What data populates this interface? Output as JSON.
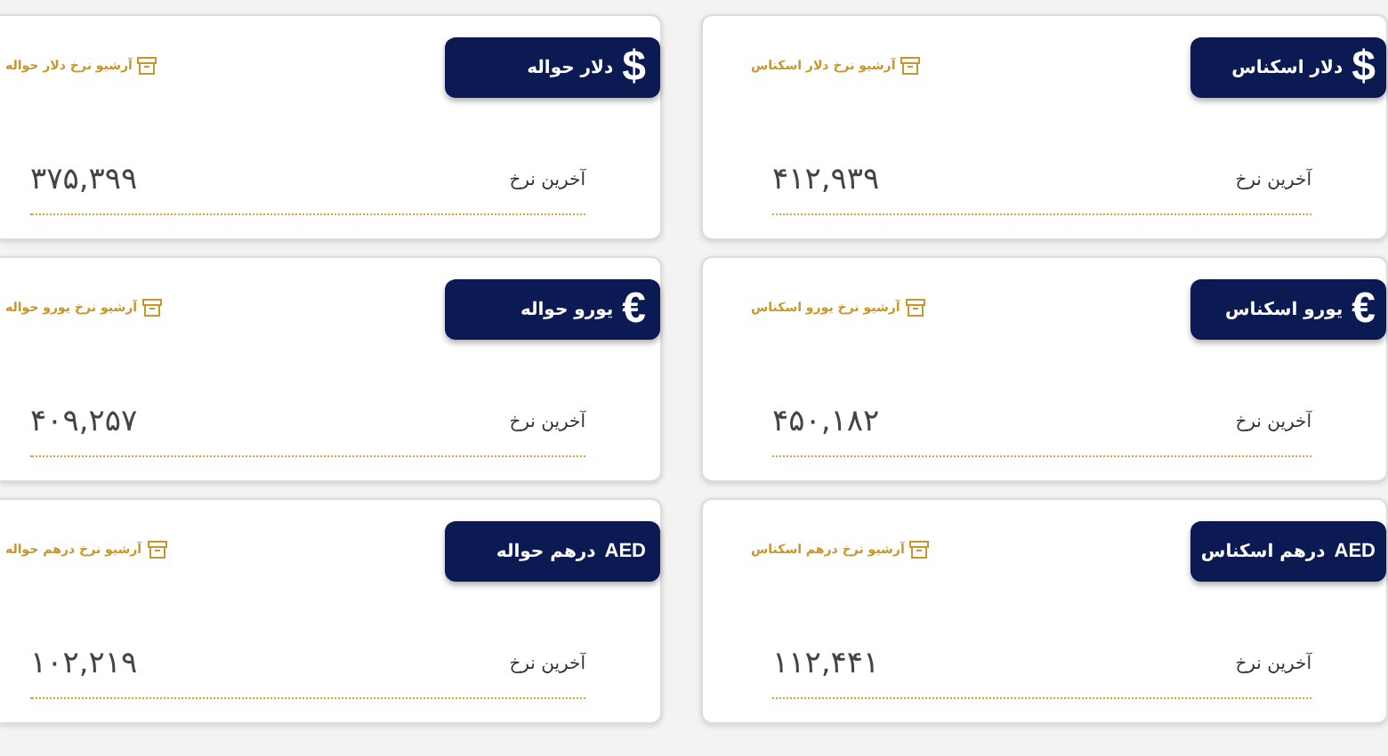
{
  "cards": [
    {
      "symbol": "$",
      "title": "دلار اسکناس",
      "archive_link": "آرشیو نرخ دلار اسکناس",
      "rate_label": "آخرین نرخ",
      "value": "۴۱۲,۹۳۹"
    },
    {
      "symbol": "$",
      "title": "دلار حواله",
      "archive_link": "آرشیو نرخ دلار حواله",
      "rate_label": "آخرین نرخ",
      "value": "۳۷۵,۳۹۹"
    },
    {
      "symbol": "€",
      "title": "یورو اسکناس",
      "archive_link": "آرشیو نرخ یورو اسکناس",
      "rate_label": "آخرین نرخ",
      "value": "۴۵۰,۱۸۲"
    },
    {
      "symbol": "€",
      "title": "یورو حواله",
      "archive_link": "آرشیو نرخ یورو حواله",
      "rate_label": "آخرین نرخ",
      "value": "۴۰۹,۲۵۷"
    },
    {
      "symbol": "AED",
      "title": "درهم اسکناس",
      "archive_link": "آرشیو نرخ درهم اسکناس",
      "rate_label": "آخرین نرخ",
      "value": "۱۱۲,۴۴۱"
    },
    {
      "symbol": "AED",
      "title": "درهم حواله",
      "archive_link": "آرشیو نرخ درهم حواله",
      "rate_label": "آخرین نرخ",
      "value": "۱۰۲,۲۱۹"
    }
  ]
}
